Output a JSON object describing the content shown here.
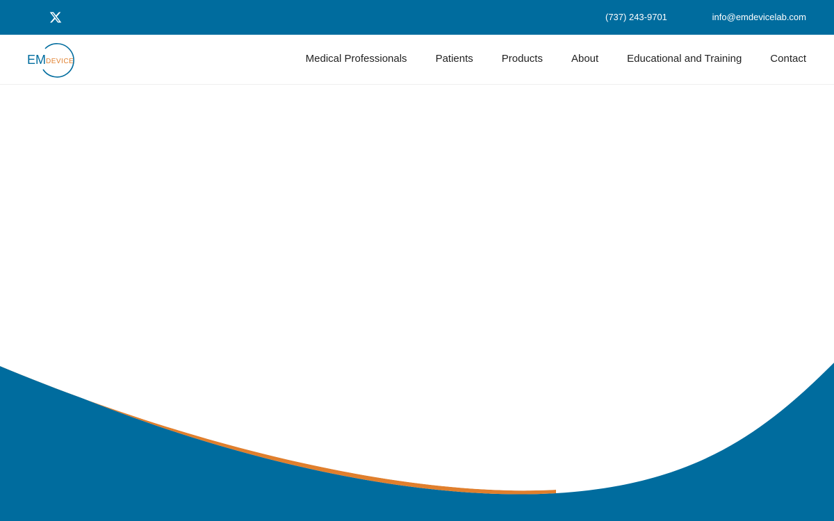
{
  "topbar": {
    "phone": "(737) 243-9701",
    "email": "info@emdevicelab.com",
    "social": [
      {
        "icon": "x-twitter-icon"
      }
    ]
  },
  "logo": {
    "primary_text": "EM",
    "secondary_text": "DEVICE"
  },
  "nav": {
    "items": [
      {
        "label": "Medical Professionals"
      },
      {
        "label": "Patients"
      },
      {
        "label": "Products"
      },
      {
        "label": "About"
      },
      {
        "label": "Educational and Training"
      },
      {
        "label": "Contact"
      }
    ]
  },
  "colors": {
    "brand_blue": "#006c9e",
    "accent_orange": "#e07f2d",
    "background": "#ffffff"
  }
}
